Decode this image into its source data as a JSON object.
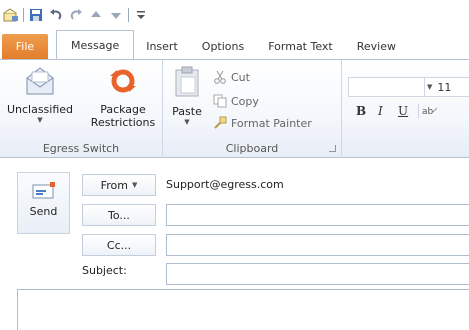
{
  "quick_access": {
    "icons": [
      "mailbox-icon",
      "save-icon",
      "undo-icon",
      "redo-icon",
      "up-icon",
      "down-icon",
      "customize-icon"
    ]
  },
  "tabs": {
    "file": "File",
    "items": [
      "Message",
      "Insert",
      "Options",
      "Format Text",
      "Review"
    ],
    "active": "Message"
  },
  "ribbon": {
    "egress": {
      "unclassified_label": "Unclassified",
      "package_label_1": "Package",
      "package_label_2": "Restrictions",
      "group_label": "Egress Switch"
    },
    "clipboard": {
      "paste_label": "Paste",
      "cut_label": "Cut",
      "copy_label": "Copy",
      "format_painter_label": "Format Painter",
      "group_label": "Clipboard"
    },
    "font": {
      "size": "11",
      "bold": "B",
      "italic": "I",
      "underline": "U"
    }
  },
  "compose": {
    "send_label": "Send",
    "from_label": "From",
    "from_value": "Support@egress.com",
    "to_label": "To...",
    "cc_label": "Cc...",
    "subject_label": "Subject:"
  },
  "colors": {
    "file_tab": "#e27e2c",
    "accent_orange": "#e8622c",
    "border_blue": "#aebdd0"
  }
}
